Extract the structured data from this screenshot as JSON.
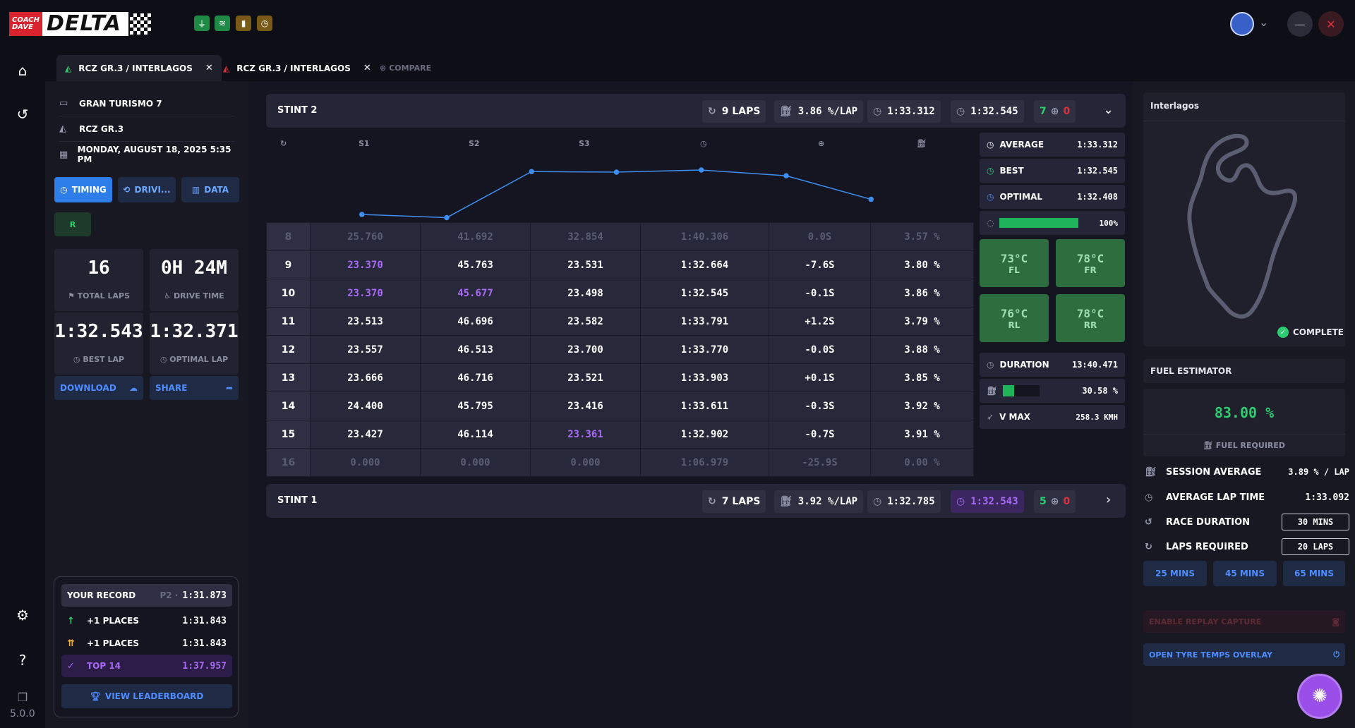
{
  "app": {
    "logo_top": "COACH",
    "logo_bottom": "DAVE",
    "logo_main": "DELTA",
    "version": "5.0.0"
  },
  "tabs": [
    {
      "label": "RCZ GR.3 / INTERLAGOS"
    },
    {
      "label": "RCZ GR.3 / INTERLAGOS"
    },
    {
      "label": "COMPARE"
    }
  ],
  "session": {
    "game": "GRAN TURISMO 7",
    "car": "RCZ GR.3",
    "date": "MONDAY, AUGUST 18, 2025 5:35 PM"
  },
  "sidebar": {
    "timing": "TIMING",
    "driving": "DRIVI...",
    "data": "DATA",
    "r_badge": "R",
    "stats": {
      "total_laps": "16",
      "total_laps_label": "TOTAL LAPS",
      "drive_time": "0H 24M",
      "drive_time_label": "DRIVE TIME",
      "best_lap": "1:32.543",
      "best_lap_label": "BEST LAP",
      "optimal_lap": "1:32.371",
      "optimal_lap_label": "OPTIMAL LAP"
    },
    "download": "DOWNLOAD",
    "share": "SHARE"
  },
  "record": {
    "title": "YOUR RECORD",
    "pos": "P2 ·",
    "time": "1:31.873",
    "rows": [
      {
        "label": "+1 PLACES",
        "time": "1:31.843"
      },
      {
        "label": "+1 PLACES",
        "time": "1:31.843"
      },
      {
        "label": "TOP 14",
        "time": "1:37.957"
      }
    ],
    "leaderboard": "VIEW LEADERBOARD"
  },
  "stint2": {
    "title": "STINT 2",
    "laps": "9 LAPS",
    "fuel": "3.86 %/LAP",
    "avg": "1:33.312",
    "best": "1:32.545",
    "valid": "7",
    "invalid": "0"
  },
  "stint1": {
    "title": "STINT 1",
    "laps": "7 LAPS",
    "fuel": "3.92 %/LAP",
    "avg": "1:32.785",
    "best": "1:32.543",
    "valid": "5",
    "invalid": "0"
  },
  "columns": {
    "s1": "S1",
    "s2": "S2",
    "s3": "S3"
  },
  "chart_data": {
    "type": "line",
    "x": [
      8,
      9,
      10,
      11,
      12,
      13,
      14
    ],
    "values": [
      98.6,
      99.2,
      90.4,
      90.5,
      90.1,
      91.2,
      95.7
    ],
    "grid": false
  },
  "laps": [
    {
      "lap": "8",
      "s1": "25.760",
      "s2": "41.692",
      "s3": "32.854",
      "time": "1:40.306",
      "delta": "0.0S",
      "fuel": "3.57 %",
      "faded": true
    },
    {
      "lap": "9",
      "s1": "23.370",
      "s2": "45.763",
      "s3": "23.531",
      "time": "1:32.664",
      "delta": "-7.6S",
      "fuel": "3.80 %",
      "p1": true
    },
    {
      "lap": "10",
      "s1": "23.370",
      "s2": "45.677",
      "s3": "23.498",
      "time": "1:32.545",
      "delta": "-0.1S",
      "fuel": "3.86 %",
      "p1": true,
      "p2": true
    },
    {
      "lap": "11",
      "s1": "23.513",
      "s2": "46.696",
      "s3": "23.582",
      "time": "1:33.791",
      "delta": "+1.2S",
      "fuel": "3.79 %"
    },
    {
      "lap": "12",
      "s1": "23.557",
      "s2": "46.513",
      "s3": "23.700",
      "time": "1:33.770",
      "delta": "-0.0S",
      "fuel": "3.88 %"
    },
    {
      "lap": "13",
      "s1": "23.666",
      "s2": "46.716",
      "s3": "23.521",
      "time": "1:33.903",
      "delta": "+0.1S",
      "fuel": "3.85 %"
    },
    {
      "lap": "14",
      "s1": "24.400",
      "s2": "45.795",
      "s3": "23.416",
      "time": "1:33.611",
      "delta": "-0.3S",
      "fuel": "3.92 %"
    },
    {
      "lap": "15",
      "s1": "23.427",
      "s2": "46.114",
      "s3": "23.361",
      "time": "1:32.902",
      "delta": "-0.7S",
      "fuel": "3.91 %",
      "p3": true
    },
    {
      "lap": "16",
      "s1": "0.000",
      "s2": "0.000",
      "s3": "0.000",
      "time": "1:06.979",
      "delta": "-25.9S",
      "fuel": "0.00 %",
      "faded": true
    }
  ],
  "summary": {
    "average_label": "AVERAGE",
    "average": "1:33.312",
    "best_label": "BEST",
    "best": "1:32.545",
    "optimal_label": "OPTIMAL",
    "optimal": "1:32.408",
    "progress": "100%",
    "progress_value": 1.0,
    "tyres": [
      {
        "temp": "73°C",
        "pos": "FL"
      },
      {
        "temp": "78°C",
        "pos": "FR"
      },
      {
        "temp": "76°C",
        "pos": "RL"
      },
      {
        "temp": "78°C",
        "pos": "RR"
      }
    ],
    "duration_label": "DURATION",
    "duration": "13:40.471",
    "fuel_pct": "30.58 %",
    "fuel_value": 0.3058,
    "vmax_label": "V MAX",
    "vmax": "258.3 KMH"
  },
  "track": {
    "name": "Interlagos",
    "status": "COMPLETE"
  },
  "fuel_estimator": {
    "title": "FUEL ESTIMATOR",
    "value": "83.00 %",
    "required_label": "FUEL REQUIRED",
    "session_avg_label": "SESSION AVERAGE",
    "session_avg": "3.89 % / LAP",
    "avg_lap_label": "AVERAGE LAP TIME",
    "avg_lap": "1:33.092",
    "race_duration_label": "RACE DURATION",
    "race_duration": "30 MINS",
    "laps_required_label": "LAPS REQUIRED",
    "laps_required": "20 LAPS",
    "presets": [
      "25 MINS",
      "45 MINS",
      "65 MINS"
    ]
  },
  "replay_capture": "ENABLE REPLAY CAPTURE",
  "tyre_overlay": "OPEN TYRE TEMPS OVERLAY",
  "colors": {
    "accent": "#2d7ee8",
    "purple": "#a86af5",
    "green": "#2ecc71",
    "red": "#e0313a"
  }
}
